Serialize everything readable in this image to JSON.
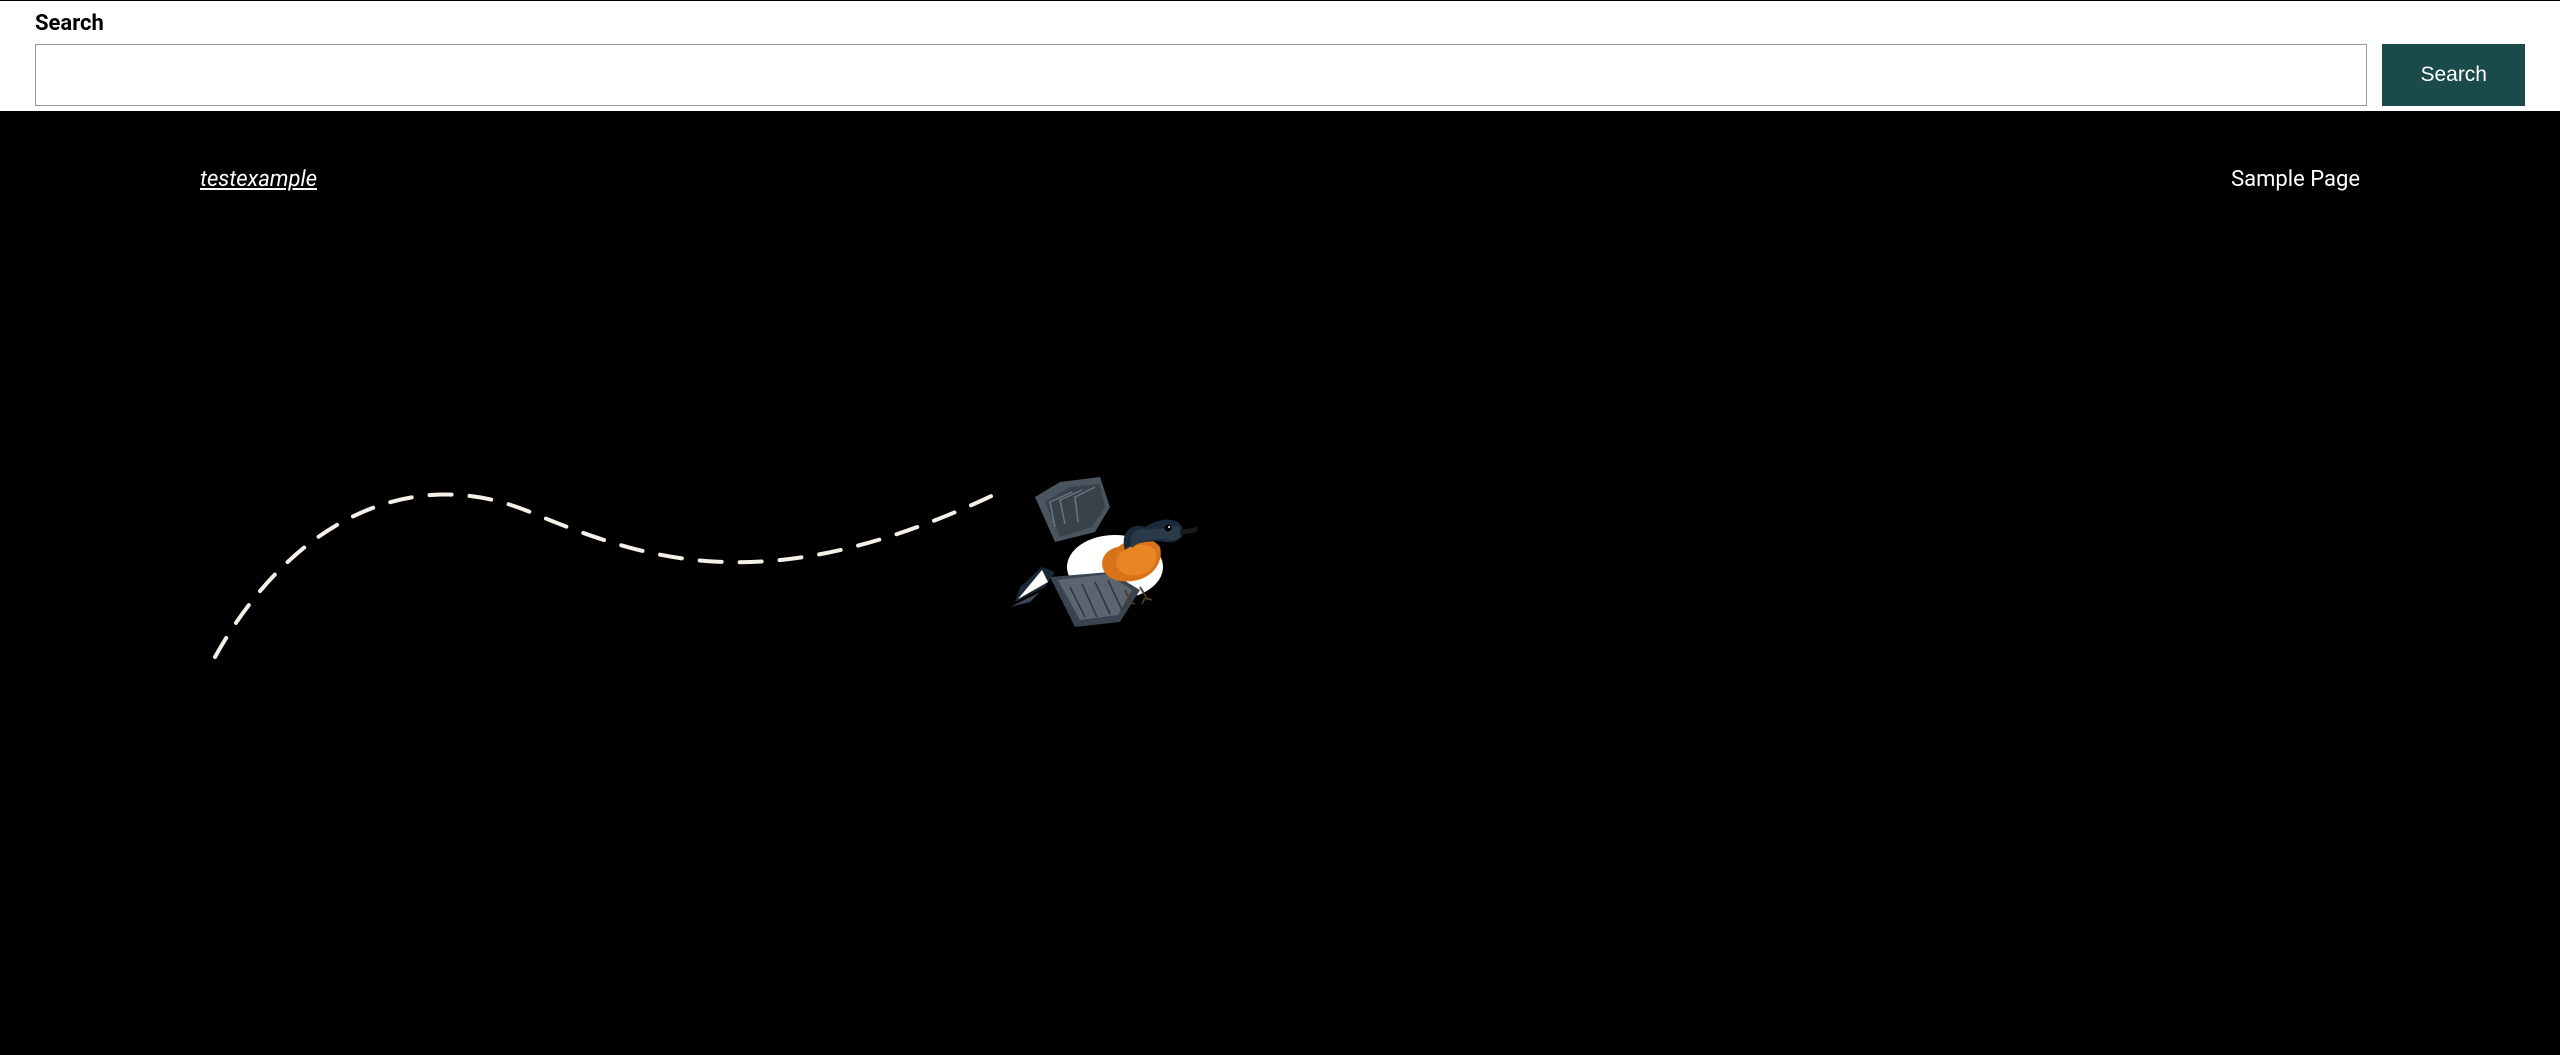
{
  "search": {
    "label": "Search",
    "button_label": "Search",
    "input_value": ""
  },
  "header": {
    "site_title": "testexample",
    "nav_items": [
      {
        "label": "Sample Page"
      }
    ]
  },
  "theme": {
    "button_bg": "#1a4a4a",
    "bg_main": "#000000",
    "text_light": "#ffffff",
    "path_color": "#f5f0e8"
  }
}
